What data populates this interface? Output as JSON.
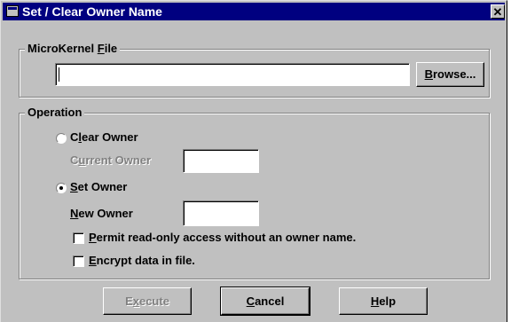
{
  "window": {
    "title": "Set / Clear Owner Name",
    "close_glyph": "✕"
  },
  "file_group": {
    "legend_pre": "MicroKernel ",
    "legend_key": "F",
    "legend_post": "ile",
    "file_value": "",
    "browse_key": "B",
    "browse_rest": "rowse..."
  },
  "operation": {
    "legend": "Operation",
    "clear_owner": {
      "key": "l",
      "pre": "C",
      "post": "ear Owner",
      "selected": false
    },
    "current_owner": {
      "key": "u",
      "pre": "C",
      "post": "rrent Owner",
      "value": ""
    },
    "set_owner": {
      "key": "S",
      "pre": "",
      "post": "et Owner",
      "selected": true
    },
    "new_owner": {
      "key": "N",
      "pre": "",
      "post": "ew Owner",
      "value": ""
    },
    "permit_readonly": {
      "key": "P",
      "post": "ermit read-only access without an owner name.",
      "checked": false
    },
    "encrypt": {
      "key": "E",
      "post": "ncrypt data in file.",
      "checked": false
    }
  },
  "buttons": {
    "execute": {
      "pre": "E",
      "key": "x",
      "post": "ecute",
      "disabled": true
    },
    "cancel": {
      "key": "C",
      "post": "ancel"
    },
    "help": {
      "key": "H",
      "post": "elp"
    }
  }
}
